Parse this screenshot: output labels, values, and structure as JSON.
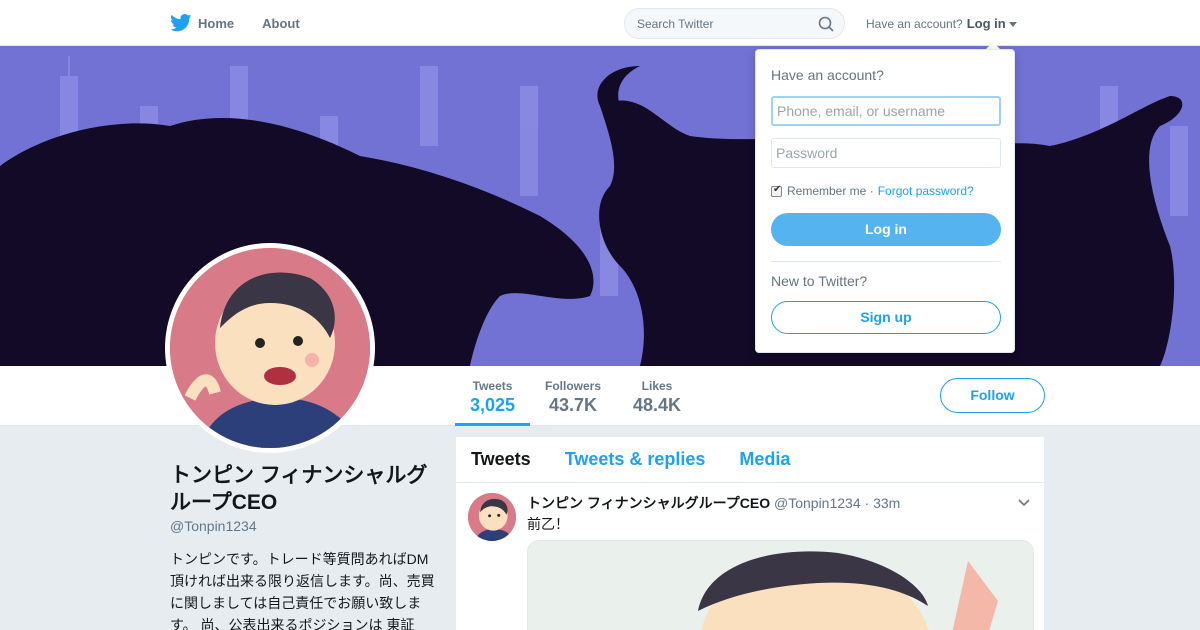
{
  "nav": {
    "home_label": "Home",
    "about_label": "About",
    "search_placeholder": "Search Twitter",
    "account_prompt": "Have an account?",
    "login_label": "Log in"
  },
  "profile": {
    "name": "トンピン フィナンシャルグループCEO",
    "handle": "@Tonpin1234",
    "bio": "トンピンです。トレード等質問あればDM頂ければ出来る限り返信します。尚、売買に関しましては自己責任でお願い致します。 尚、公表出来るポジションは 東証",
    "stats": [
      {
        "label": "Tweets",
        "value": "3,025"
      },
      {
        "label": "Followers",
        "value": "43.7K"
      },
      {
        "label": "Likes",
        "value": "48.4K"
      }
    ],
    "follow_label": "Follow"
  },
  "timeline": {
    "tabs": [
      "Tweets",
      "Tweets & replies",
      "Media"
    ],
    "tweet": {
      "name": "トンピン フィナンシャルグループCEO",
      "handle": "@Tonpin1234",
      "dot": "·",
      "time": "33m",
      "text": "前乙！"
    }
  },
  "login_dropdown": {
    "title": "Have an account?",
    "username_placeholder": "Phone, email, or username",
    "password_placeholder": "Password",
    "remember_label": "Remember me ·",
    "forgot_label": "Forgot password?",
    "login_button": "Log in",
    "new_prompt": "New to Twitter?",
    "signup_button": "Sign up"
  },
  "colors": {
    "accent": "#1da1f2",
    "banner": "#6f6fd0",
    "avatar_bg": "#d97a88"
  }
}
